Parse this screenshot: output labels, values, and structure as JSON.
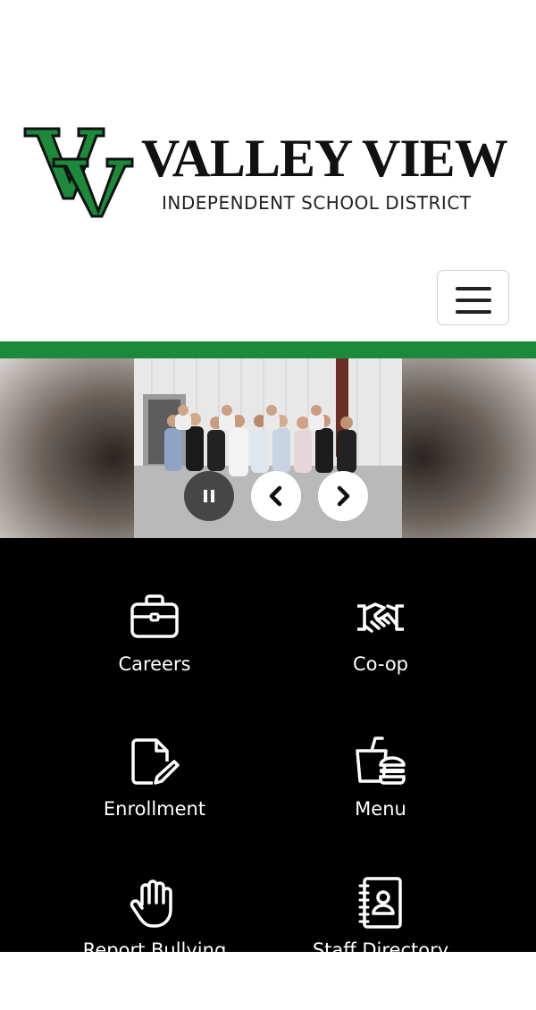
{
  "header": {
    "logo": {
      "monogram": "VV",
      "name": "VALLEY VIEW",
      "subtitle": "INDEPENDENT SCHOOL DISTRICT"
    },
    "menu_toggle_icon": "hamburger-icon"
  },
  "colors": {
    "brand_green": "#1c8a3a",
    "quick_links_bg": "#000000"
  },
  "carousel": {
    "controls": {
      "pause_icon": "pause-icon",
      "prev_icon": "chevron-left-icon",
      "next_icon": "chevron-right-icon"
    }
  },
  "quick_links": [
    {
      "label": "Careers",
      "icon": "briefcase-icon"
    },
    {
      "label": "Co-op",
      "icon": "handshake-icon"
    },
    {
      "label": "Enrollment",
      "icon": "document-edit-icon"
    },
    {
      "label": "Menu",
      "icon": "food-menu-icon"
    },
    {
      "label": "Report Bullying",
      "icon": "raised-hand-icon"
    },
    {
      "label": "Staff Directory",
      "icon": "contact-book-icon"
    }
  ]
}
